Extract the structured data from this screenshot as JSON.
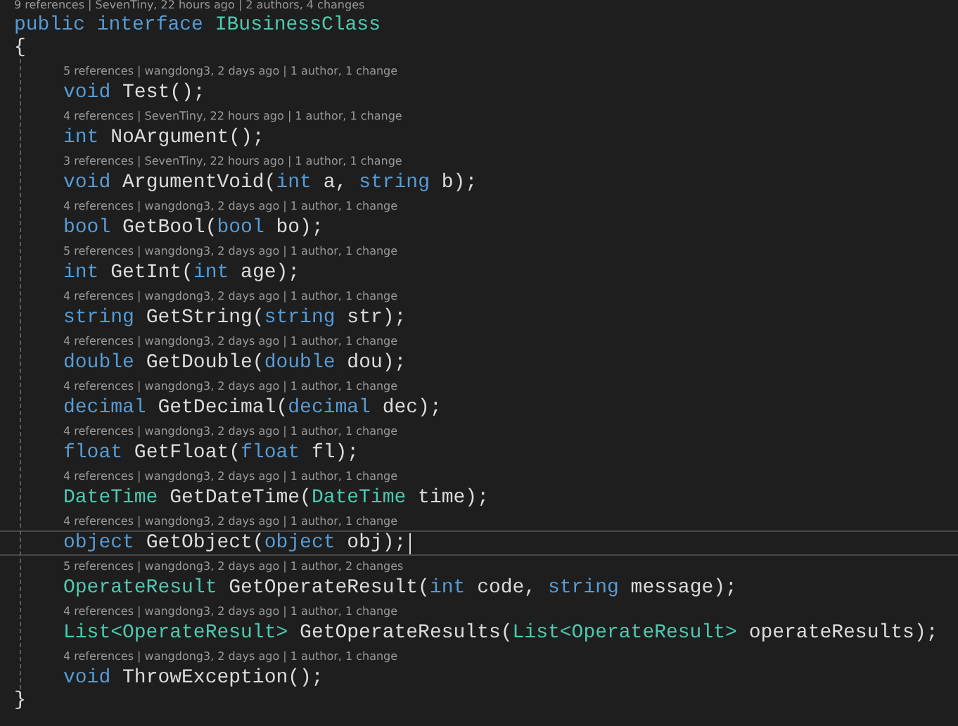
{
  "editor": {
    "header_lens": "9 references | SevenTiny, 22 hours ago | 2 authors, 4 changes",
    "declaration": [
      {
        "text": "public",
        "kind": "keyword"
      },
      {
        "text": "interface",
        "kind": "keyword"
      },
      {
        "text": "IBusinessClass",
        "kind": "type"
      }
    ],
    "open_brace": "{",
    "members": [
      {
        "lens": "5 references | wangdong3, 2 days ago | 1 author, 1 change",
        "selected": false,
        "tokens": [
          {
            "text": "void",
            "kind": "keyword"
          },
          {
            "text": " Test();",
            "kind": "plain"
          }
        ]
      },
      {
        "lens": "4 references | SevenTiny, 22 hours ago | 1 author, 1 change",
        "selected": false,
        "tokens": [
          {
            "text": "int",
            "kind": "keyword"
          },
          {
            "text": " NoArgument();",
            "kind": "plain"
          }
        ]
      },
      {
        "lens": "3 references | SevenTiny, 22 hours ago | 1 author, 1 change",
        "selected": false,
        "tokens": [
          {
            "text": "void",
            "kind": "keyword"
          },
          {
            "text": " ArgumentVoid(",
            "kind": "plain"
          },
          {
            "text": "int",
            "kind": "keyword"
          },
          {
            "text": " a, ",
            "kind": "plain"
          },
          {
            "text": "string",
            "kind": "keyword"
          },
          {
            "text": " b);",
            "kind": "plain"
          }
        ]
      },
      {
        "lens": "4 references | wangdong3, 2 days ago | 1 author, 1 change",
        "selected": false,
        "tokens": [
          {
            "text": "bool",
            "kind": "keyword"
          },
          {
            "text": " GetBool(",
            "kind": "plain"
          },
          {
            "text": "bool",
            "kind": "keyword"
          },
          {
            "text": " bo);",
            "kind": "plain"
          }
        ]
      },
      {
        "lens": "5 references | wangdong3, 2 days ago | 1 author, 1 change",
        "selected": false,
        "tokens": [
          {
            "text": "int",
            "kind": "keyword"
          },
          {
            "text": " GetInt(",
            "kind": "plain"
          },
          {
            "text": "int",
            "kind": "keyword"
          },
          {
            "text": " age);",
            "kind": "plain"
          }
        ]
      },
      {
        "lens": "4 references | wangdong3, 2 days ago | 1 author, 1 change",
        "selected": false,
        "tokens": [
          {
            "text": "string",
            "kind": "keyword"
          },
          {
            "text": " GetString(",
            "kind": "plain"
          },
          {
            "text": "string",
            "kind": "keyword"
          },
          {
            "text": " str);",
            "kind": "plain"
          }
        ]
      },
      {
        "lens": "4 references | wangdong3, 2 days ago | 1 author, 1 change",
        "selected": false,
        "tokens": [
          {
            "text": "double",
            "kind": "keyword"
          },
          {
            "text": " GetDouble(",
            "kind": "plain"
          },
          {
            "text": "double",
            "kind": "keyword"
          },
          {
            "text": " dou);",
            "kind": "plain"
          }
        ]
      },
      {
        "lens": "4 references | wangdong3, 2 days ago | 1 author, 1 change",
        "selected": false,
        "tokens": [
          {
            "text": "decimal",
            "kind": "keyword"
          },
          {
            "text": " GetDecimal(",
            "kind": "plain"
          },
          {
            "text": "decimal",
            "kind": "keyword"
          },
          {
            "text": " dec);",
            "kind": "plain"
          }
        ]
      },
      {
        "lens": "4 references | wangdong3, 2 days ago | 1 author, 1 change",
        "selected": false,
        "tokens": [
          {
            "text": "float",
            "kind": "keyword"
          },
          {
            "text": " GetFloat(",
            "kind": "plain"
          },
          {
            "text": "float",
            "kind": "keyword"
          },
          {
            "text": " fl);",
            "kind": "plain"
          }
        ]
      },
      {
        "lens": "4 references | wangdong3, 2 days ago | 1 author, 1 change",
        "selected": false,
        "tokens": [
          {
            "text": "DateTime",
            "kind": "type"
          },
          {
            "text": " GetDateTime(",
            "kind": "plain"
          },
          {
            "text": "DateTime",
            "kind": "type"
          },
          {
            "text": " time);",
            "kind": "plain"
          }
        ]
      },
      {
        "lens": "4 references | wangdong3, 2 days ago | 1 author, 1 change",
        "selected": true,
        "tokens": [
          {
            "text": "object",
            "kind": "keyword"
          },
          {
            "text": " GetObject(",
            "kind": "plain"
          },
          {
            "text": "object",
            "kind": "keyword"
          },
          {
            "text": " obj);",
            "kind": "plain"
          }
        ]
      },
      {
        "lens": "5 references | wangdong3, 2 days ago | 1 author, 2 changes",
        "selected": false,
        "tokens": [
          {
            "text": "OperateResult",
            "kind": "type"
          },
          {
            "text": " GetOperateResult(",
            "kind": "plain"
          },
          {
            "text": "int",
            "kind": "keyword"
          },
          {
            "text": " code, ",
            "kind": "plain"
          },
          {
            "text": "string",
            "kind": "keyword"
          },
          {
            "text": " message);",
            "kind": "plain"
          }
        ]
      },
      {
        "lens": "4 references | wangdong3, 2 days ago | 1 author, 1 change",
        "selected": false,
        "tokens": [
          {
            "text": "List<OperateResult>",
            "kind": "type"
          },
          {
            "text": " GetOperateResults(",
            "kind": "plain"
          },
          {
            "text": "List<OperateResult>",
            "kind": "type"
          },
          {
            "text": " operateResults);",
            "kind": "plain"
          }
        ]
      },
      {
        "lens": "4 references | wangdong3, 2 days ago | 1 author, 1 change",
        "selected": false,
        "tokens": [
          {
            "text": "void",
            "kind": "keyword"
          },
          {
            "text": " ThrowException();",
            "kind": "plain"
          }
        ]
      }
    ],
    "close_brace": "}"
  }
}
